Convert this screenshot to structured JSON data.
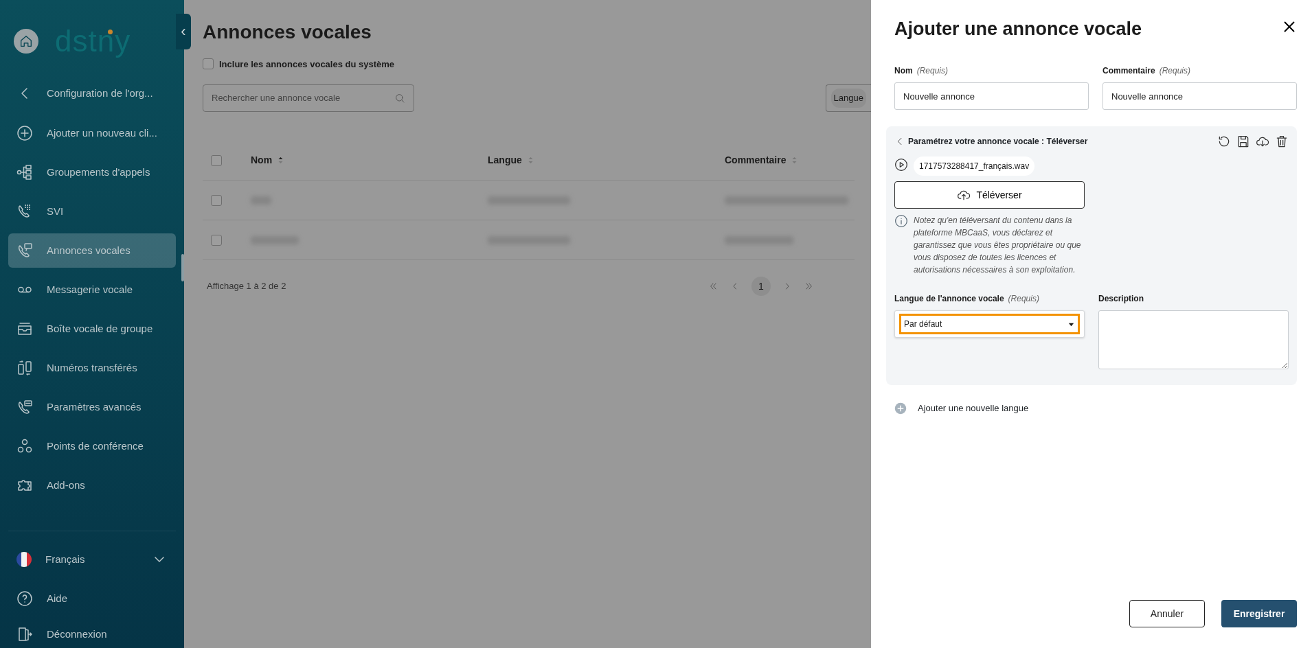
{
  "sidebar": {
    "logo": "dstny",
    "collapse": "‹",
    "back": {
      "label": "Configuration de l'org..."
    },
    "items": [
      {
        "label": "Ajouter un nouveau cli...",
        "selected": false
      },
      {
        "label": "Groupements d'appels",
        "selected": false
      },
      {
        "label": "SVI",
        "selected": false
      },
      {
        "label": "Annonces vocales",
        "selected": true
      },
      {
        "label": "Messagerie vocale",
        "selected": false
      },
      {
        "label": "Boîte vocale de groupe",
        "selected": false
      },
      {
        "label": "Numéros transférés",
        "selected": false
      },
      {
        "label": "Paramètres avancés",
        "selected": false
      },
      {
        "label": "Points de conférence",
        "selected": false
      },
      {
        "label": "Add-ons",
        "selected": false
      }
    ],
    "footer": [
      {
        "label": "Français",
        "kind": "language"
      },
      {
        "label": "Aide",
        "kind": "help"
      },
      {
        "label": "Déconnexion",
        "kind": "logout"
      }
    ]
  },
  "main": {
    "title": "Annonces vocales",
    "include_system": {
      "label": "Inclure les annonces vocales du système",
      "checked": false
    },
    "search": {
      "placeholder": "Rechercher une annonce vocale"
    },
    "filter": {
      "label": "Langue"
    },
    "table": {
      "select_all": {
        "checked": false
      },
      "columns": [
        {
          "label": "Nom",
          "sorted": true
        },
        {
          "label": "Langue",
          "sorted": false
        },
        {
          "label": "Commentaire",
          "sorted": false
        }
      ],
      "rows": [
        {
          "selected": false
        },
        {
          "selected": false
        }
      ]
    },
    "summary": "Affichage 1 à 2 de 2",
    "pages": [
      {
        "label": "1",
        "selected": true
      }
    ]
  },
  "drawer": {
    "title": "Ajouter une annonce vocale",
    "fields": [
      {
        "label": "Nom",
        "required": "(Requis)",
        "value": "Nouvelle annonce"
      },
      {
        "label": "Commentaire",
        "required": "(Requis)",
        "value": "Nouvelle annonce"
      }
    ],
    "panel": {
      "title": "Paramétrez votre annonce vocale : Téléverser",
      "file": "1717573288417_français.wav",
      "upload": "Téléverser",
      "notice": "Notez qu'en téléversant du contenu dans la plateforme MBCaaS, vous déclarez et garantissez que vous êtes propriétaire ou que vous disposez de toutes les licences et autorisations nécessaires à son exploitation.",
      "language": {
        "label": "Langue de l'annonce vocale",
        "required": "(Requis)",
        "value": "Par défaut",
        "highlighted": true
      },
      "description": {
        "label": "Description"
      }
    },
    "add_language": "Ajouter une nouvelle langue",
    "buttons": [
      {
        "label": "Annuler",
        "kind": "secondary"
      },
      {
        "label": "Enregistrer",
        "kind": "primary"
      }
    ]
  }
}
